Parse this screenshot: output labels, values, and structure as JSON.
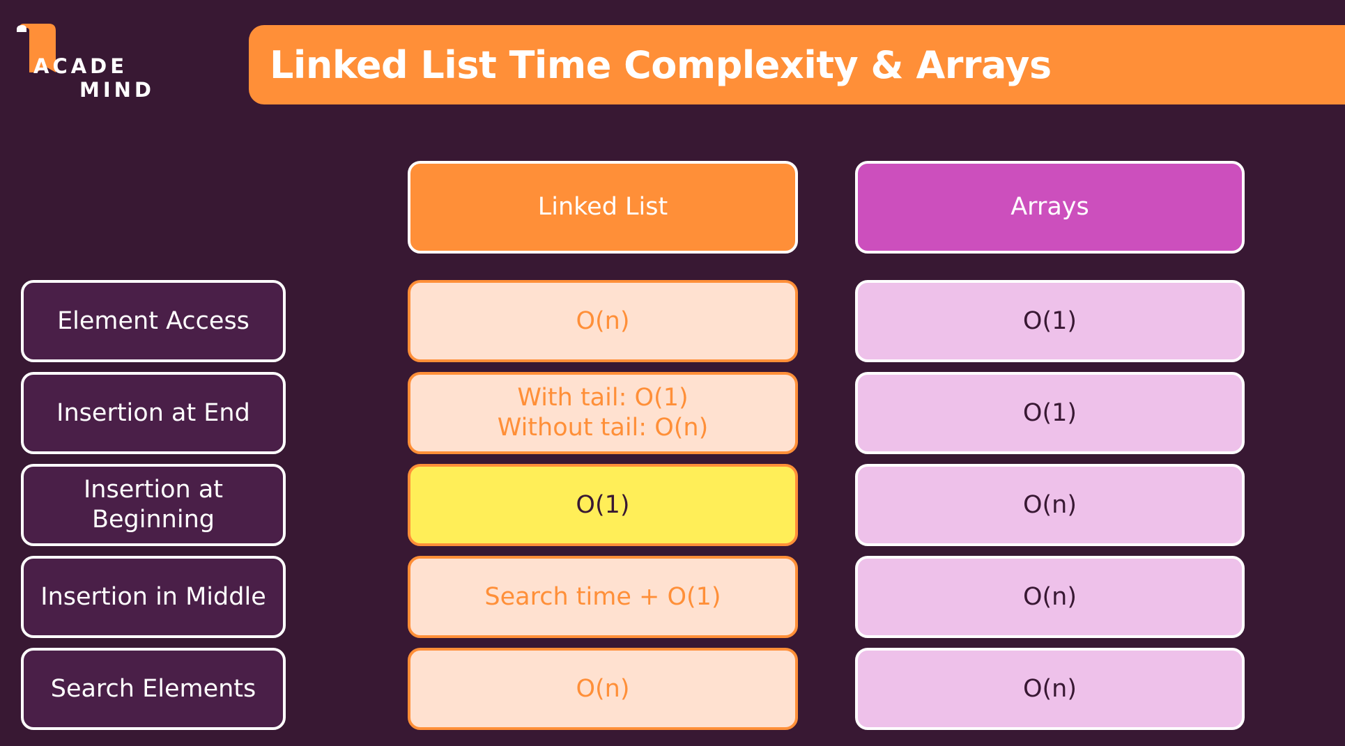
{
  "logo": {
    "line1": "ACADE",
    "line2": "MIND"
  },
  "title": "Linked List Time Complexity & Arrays",
  "columns": {
    "linked_list": "Linked List",
    "arrays": "Arrays"
  },
  "rows": [
    {
      "label": "Element Access",
      "linked_list": "O(n)",
      "arrays": "O(1)"
    },
    {
      "label": "Insertion at End",
      "linked_list_line1": "With tail: O(1)",
      "linked_list_line2": "Without tail: O(n)",
      "arrays": "O(1)"
    },
    {
      "label": "Insertion at Beginning",
      "linked_list": "O(1)",
      "arrays": "O(n)",
      "highlight": true
    },
    {
      "label": "Insertion in Middle",
      "linked_list": "Search time + O(1)",
      "arrays": "O(n)"
    },
    {
      "label": "Search Elements",
      "linked_list": "O(n)",
      "arrays": "O(n)"
    }
  ],
  "colors": {
    "background": "#381833",
    "orange": "#ff8f38",
    "magenta": "#cc4fbd",
    "linked_list_cell": "#ffe1d0",
    "arrays_cell": "#eec1ea",
    "highlight": "#ffee58",
    "row_label": "#4a1f48"
  }
}
